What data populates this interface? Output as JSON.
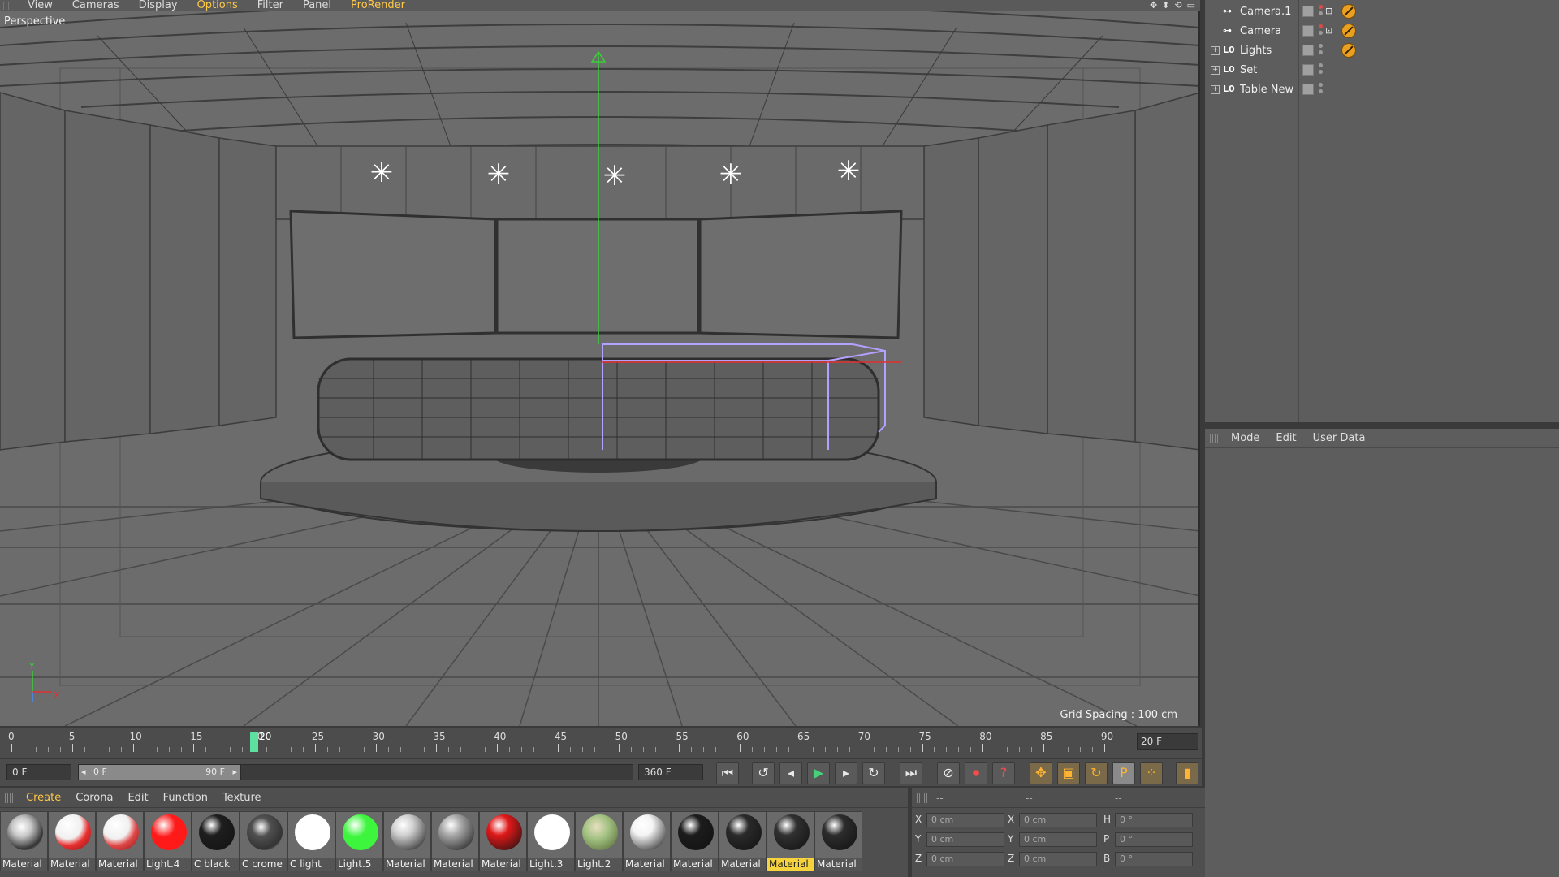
{
  "viewport": {
    "menu": [
      "View",
      "Cameras",
      "Display",
      "Options",
      "Filter",
      "Panel",
      "ProRender"
    ],
    "highlighted_menu": [
      "Options",
      "ProRender"
    ],
    "label": "Perspective",
    "grid_spacing": "Grid Spacing : 100 cm",
    "axis_y": "Y",
    "axis_x": "X"
  },
  "object_manager": {
    "objects": [
      {
        "name": "Camera.1",
        "icon": "camera-icon",
        "expandable": false,
        "protection_tag": true
      },
      {
        "name": "Camera",
        "icon": "camera-icon",
        "expandable": false,
        "protection_tag": true
      },
      {
        "name": "Lights",
        "icon": "null-object-icon",
        "icon_text": "L0",
        "expandable": true,
        "expand_glyph": "+",
        "protection_tag": true
      },
      {
        "name": "Set",
        "icon": "null-object-icon",
        "icon_text": "L0",
        "expandable": true,
        "expand_glyph": "+",
        "protection_tag": false
      },
      {
        "name": "Table New",
        "icon": "null-object-icon",
        "icon_text": "L0",
        "expandable": true,
        "expand_glyph": "+",
        "protection_tag": false
      }
    ]
  },
  "attribute_manager": {
    "tabs": [
      "Mode",
      "Edit",
      "User Data"
    ]
  },
  "timeline": {
    "ticks": [
      "0",
      "5",
      "10",
      "15",
      "20",
      "25",
      "30",
      "35",
      "40",
      "45",
      "50",
      "55",
      "60",
      "65",
      "70",
      "75",
      "80",
      "85",
      "90"
    ],
    "current_frame": 20,
    "current_frame_label": "20",
    "end_frame_field": "20 F"
  },
  "transport": {
    "current_frame_field": "0 F",
    "range_start": "0 F",
    "range_end": "90 F",
    "range_left_arrow": "◂",
    "range_right_arrow": "▸",
    "max_frame_field": "360 F"
  },
  "material_manager": {
    "menu": [
      "Create",
      "Corona",
      "Edit",
      "Function",
      "Texture"
    ],
    "materials": [
      {
        "name": "Material",
        "color": "#c8c8c8",
        "style": "chrome",
        "selected": false
      },
      {
        "name": "Material",
        "color": "#e83030",
        "style": "red-white",
        "selected": false
      },
      {
        "name": "Material",
        "color": "#e04848",
        "style": "red-white",
        "selected": false
      },
      {
        "name": "Light.4",
        "color": "#ff1a1a",
        "style": "solid",
        "selected": false
      },
      {
        "name": "C black",
        "color": "#1e1e1e",
        "style": "glossy",
        "selected": false
      },
      {
        "name": "C crome",
        "color": "#505050",
        "style": "chrome",
        "selected": false
      },
      {
        "name": "C light",
        "color": "#ffffff",
        "style": "solid",
        "selected": false
      },
      {
        "name": "Light.5",
        "color": "#3cf53c",
        "style": "solid",
        "selected": false
      },
      {
        "name": "Material",
        "color": "#d0d0d0",
        "style": "glossy",
        "selected": false
      },
      {
        "name": "Material",
        "color": "#a8a8a8",
        "style": "glossy",
        "selected": false
      },
      {
        "name": "Material",
        "color": "#e01818",
        "style": "glossy",
        "selected": false
      },
      {
        "name": "Light.3",
        "color": "#ffffff",
        "style": "solid",
        "selected": false
      },
      {
        "name": "Light.2",
        "color": "#a0c080",
        "style": "texture",
        "selected": false
      },
      {
        "name": "Material",
        "color": "#f4f4f4",
        "style": "glossy",
        "selected": false
      },
      {
        "name": "Material",
        "color": "#1c1c1c",
        "style": "glossy",
        "selected": false
      },
      {
        "name": "Material",
        "color": "#2a2a2a",
        "style": "glossy",
        "selected": false
      },
      {
        "name": "Material",
        "color": "#303030",
        "style": "glossy",
        "selected": true
      },
      {
        "name": "Material",
        "color": "#2c2c2c",
        "style": "glossy",
        "selected": false
      }
    ]
  },
  "coordinates": {
    "headers": [
      "--",
      "--",
      "--"
    ],
    "rows": [
      {
        "a_label": "X",
        "a_value": "0 cm",
        "b_label": "X",
        "b_value": "0 cm",
        "c_label": "H",
        "c_value": "0 °"
      },
      {
        "a_label": "Y",
        "a_value": "0 cm",
        "b_label": "Y",
        "b_value": "0 cm",
        "c_label": "P",
        "c_value": "0 °"
      },
      {
        "a_label": "Z",
        "a_value": "0 cm",
        "b_label": "Z",
        "b_value": "0 cm",
        "c_label": "B",
        "c_value": "0 °"
      }
    ]
  },
  "colors": {
    "accent": "#ffc846",
    "play": "#46d27a",
    "playhead": "#5de0a0",
    "y_axis": "#3ad03a",
    "x_axis": "#e03030",
    "selection": "#b4a0ff"
  }
}
